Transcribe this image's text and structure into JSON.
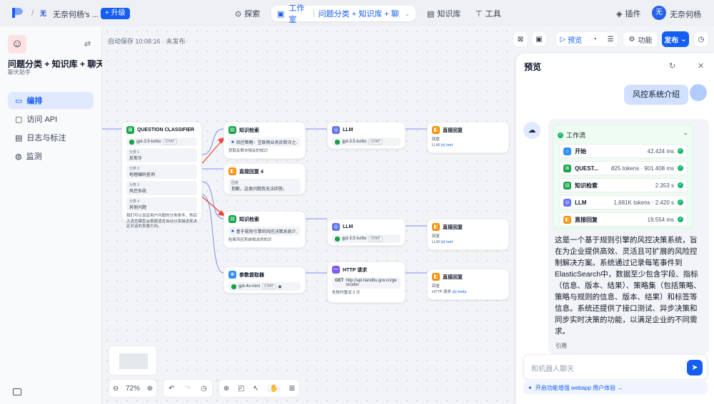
{
  "topbar": {
    "workspace_badge": "无",
    "workspace_name": "无奈何杨's ...",
    "upgrade": "+ 升级",
    "nav": {
      "explore": "探索",
      "studio": "工作室",
      "app_tab": "问题分类 + 知识库 + 聊天...",
      "knowledge": "知识库",
      "tools": "工具",
      "plugins": "插件"
    },
    "user_avatar": "无",
    "user_name": "无奈何杨"
  },
  "sidebar": {
    "app_title": "问题分类 + 知识库 + 聊天...",
    "app_subtitle": "聊天助手",
    "menu": [
      "编排",
      "访问 API",
      "日志与标注",
      "监测"
    ]
  },
  "canvas": {
    "autosave": "自动保存 10:08:16 · 未发布",
    "zoom": "72%",
    "toolbar": {
      "preview": "预览",
      "features": "功能",
      "publish": "发布"
    },
    "nodes": {
      "classifier": {
        "title": "QUESTION CLASSIFIER",
        "model": "gpt-3.5-turbo",
        "model_tag": "CHAT",
        "classes": [
          {
            "label": "分类 1",
            "value": "反欺诈"
          },
          {
            "label": "分类 2",
            "value": "地理编码查询"
          },
          {
            "label": "分类 3",
            "value": "风控系统"
          },
          {
            "label": "分类 4",
            "value": "其他问题"
          }
        ],
        "desc": "我们可以设定用户问题的分类条件，然后大语言模型会根据语言自动分类描述来决定对话的发展方向。"
      },
      "kr1": {
        "title": "知识检索",
        "dataset": "风控策略：互联网业务反欺诈之...",
        "desc": "获取反欺诈相关的知识"
      },
      "reply4": {
        "title": "直接回复 4",
        "label": "回复",
        "text": "抱歉，这类问题我无法回答。"
      },
      "kr2": {
        "title": "知识检索",
        "dataset": "基于规则引擎的风控决策系统介...",
        "desc": "检索风控系统相关的知识"
      },
      "param": {
        "title": "参数提取器",
        "model": "gpt-4o-mini",
        "model_tag": "CHAT"
      },
      "llm1": {
        "title": "LLM",
        "model": "gpt-3.5-turbo",
        "model_tag": "CHAT"
      },
      "llm2": {
        "title": "LLM",
        "model": "gpt-3.5-turbo",
        "model_tag": "CHAT"
      },
      "http": {
        "title": "HTTP 请求",
        "method": "GET",
        "url": "http://api.tianditu.gov.cn/geocoder",
        "retry": "失败时重试 3 次"
      },
      "reply1": {
        "title": "直接回复",
        "label": "回复",
        "src": "LLM",
        "var": "{x} text"
      },
      "reply2": {
        "title": "直接回复",
        "label": "回复",
        "src": "LLM",
        "var": "{x} text"
      },
      "reply3": {
        "title": "直接回复",
        "label": "回复",
        "src": "HTTP 请求",
        "var": "{x} body"
      }
    }
  },
  "preview": {
    "title": "预览",
    "question": "风控系统介绍",
    "workflow_label": "工作流",
    "steps": [
      {
        "name": "开始",
        "meta": "42.424 ms"
      },
      {
        "name": "QUEST...",
        "meta": "825 tokens · 901.408 ms"
      },
      {
        "name": "知识检索",
        "meta": "2.353 s"
      },
      {
        "name": "LLM",
        "meta": "1,681K tokens · 2.420 s"
      },
      {
        "name": "直接回复",
        "meta": "19.554 ms"
      }
    ],
    "answer": "这是一个基于规则引擎的风控决策系统，旨在为企业提供高效、灵活且可扩展的风险控制解决方案。系统通过记录每笔事件到ElasticSearch中，数据至少包含字段、指标（信息、版本、结果）、策略集（包括策略、策略与规则的信息、版本、结果）和标签等信息。系统还提供了接口测试、异步决策和同步实时决策的功能，以满足企业的不同需求。",
    "citation": "引用",
    "input_placeholder": "和机器人聊天",
    "enhance": "开启功能增强 webapp 用户体验 →"
  }
}
